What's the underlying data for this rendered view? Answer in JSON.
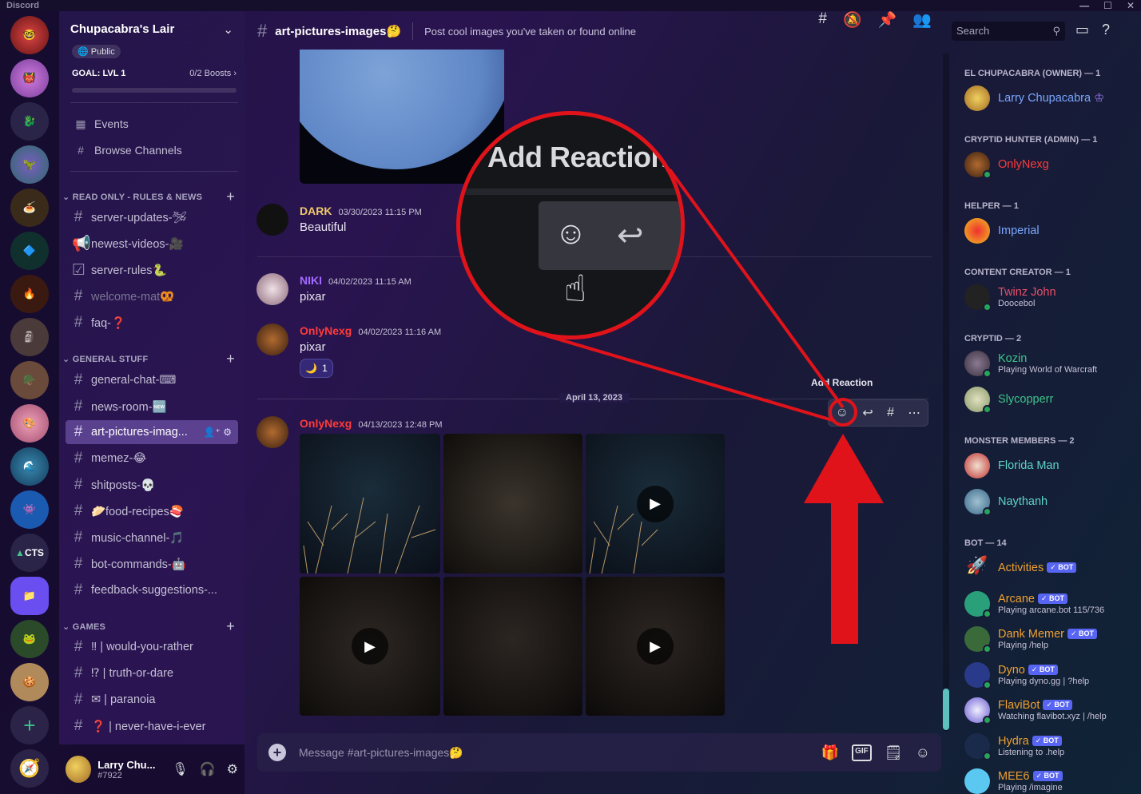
{
  "app": {
    "title": "Discord"
  },
  "window_controls": [
    "—",
    "☐",
    "✕"
  ],
  "server": {
    "name": "Chupacabra's Lair",
    "public_label": "Public",
    "goal_label": "GOAL: LVL 1",
    "boosts_label": "0/2 Boosts"
  },
  "rail": {
    "cts_label": "CTS"
  },
  "nav": {
    "events": "Events",
    "browse": "Browse Channels"
  },
  "categories": {
    "readonly": "READ ONLY - RULES & NEWS",
    "general": "GENERAL STUFF",
    "games": "GAMES"
  },
  "channels": [
    {
      "label": "server-updates-🛩"
    },
    {
      "label": "newest-videos-🎥"
    },
    {
      "label": "server-rules🐍"
    },
    {
      "label": "welcome-mat🥨"
    },
    {
      "label": "faq-❓"
    },
    {
      "label": "general-chat-⌨"
    },
    {
      "label": "news-room-🆕"
    },
    {
      "label": "art-pictures-imag..."
    },
    {
      "label": "memez-😂"
    },
    {
      "label": "shitposts-💀"
    },
    {
      "label": "🥟food-recipes🍣"
    },
    {
      "label": "music-channel-🎵"
    },
    {
      "label": "bot-commands-🤖"
    },
    {
      "label": "feedback-suggestions-..."
    },
    {
      "label": "‼ | would-you-rather"
    },
    {
      "label": "⁉ | truth-or-dare"
    },
    {
      "label": "✉ | paranoia"
    },
    {
      "label": "❓ | never-have-i-ever"
    }
  ],
  "user": {
    "name": "Larry Chu...",
    "tag": "#7922"
  },
  "header": {
    "channel": "art-pictures-images🤔",
    "topic": "Post cool images you've taken or found online",
    "search_placeholder": "Search"
  },
  "messages": [
    {
      "author": "DARK",
      "time": "03/30/2023 11:15 PM",
      "text": "Beautiful",
      "color": "#f0c96a"
    },
    {
      "author": "NIKI",
      "time": "04/02/2023 11:15 AM",
      "text": "pixar",
      "color": "#a46bff"
    },
    {
      "author": "OnlyNexg",
      "time": "04/02/2023 11:16 AM",
      "text": "pixar",
      "color": "#ff3b3b"
    },
    {
      "author": "OnlyNexg",
      "time": "04/13/2023 12:48 PM",
      "text": "",
      "color": "#ff3b3b"
    }
  ],
  "reaction": {
    "emoji": "🌙",
    "count": "1"
  },
  "date_divider": "April 13, 2023",
  "tooltip": "Add Reaction",
  "zoom_text": "Add Reaction",
  "composer": {
    "placeholder": "Message #art-pictures-images🤔",
    "gif_label": "GIF"
  },
  "member_groups": [
    {
      "title": "EL CHUPACABRA (OWNER) — 1"
    },
    {
      "title": "CRYPTID HUNTER (ADMIN) — 1"
    },
    {
      "title": "HELPER — 1"
    },
    {
      "title": "CONTENT CREATOR — 1"
    },
    {
      "title": "CRYPTID — 2"
    },
    {
      "title": "MONSTER MEMBERS — 2"
    },
    {
      "title": "BOT — 14"
    }
  ],
  "members": [
    {
      "name": "Larry Chupacabra",
      "activity": "",
      "color": "#7aa7ff"
    },
    {
      "name": "OnlyNexg",
      "activity": "",
      "color": "#ff3b3b"
    },
    {
      "name": "Imperial",
      "activity": "",
      "color": "#7aa7ff"
    },
    {
      "name": "Twinz John",
      "activity": "Doocebol",
      "color": "#e84e6a"
    },
    {
      "name": "Kozin",
      "activity": "Playing World of Warcraft",
      "color": "#3fc48a"
    },
    {
      "name": "Slycopperr",
      "activity": "",
      "color": "#3fc48a"
    },
    {
      "name": "Florida Man",
      "activity": "",
      "color": "#5fd3c8"
    },
    {
      "name": "Naythanh",
      "activity": "",
      "color": "#5fd3c8"
    },
    {
      "name": "Activities",
      "activity": "",
      "color": "#f0a030",
      "bot": "✓ BOT"
    },
    {
      "name": "Arcane",
      "activity": "Playing arcane.bot 115/736",
      "color": "#f0a030",
      "bot": "✓ BOT"
    },
    {
      "name": "Dank Memer",
      "activity": "Playing /help",
      "color": "#f0a030",
      "bot": "✓ BOT"
    },
    {
      "name": "Dyno",
      "activity": "Playing dyno.gg | ?help",
      "color": "#f0a030",
      "bot": "✓ BOT"
    },
    {
      "name": "FlaviBot",
      "activity": "Watching flavibot.xyz | /help",
      "color": "#f0a030",
      "bot": "✓ BOT"
    },
    {
      "name": "Hydra",
      "activity": "Listening to .help",
      "color": "#f0a030",
      "bot": "✓ BOT"
    },
    {
      "name": "MEE6",
      "activity": "Playing /imagine",
      "color": "#f0a030",
      "bot": "✓ BOT"
    }
  ],
  "colors": {
    "annotation_red": "#e1131a",
    "active_channel": "#9678dc"
  }
}
